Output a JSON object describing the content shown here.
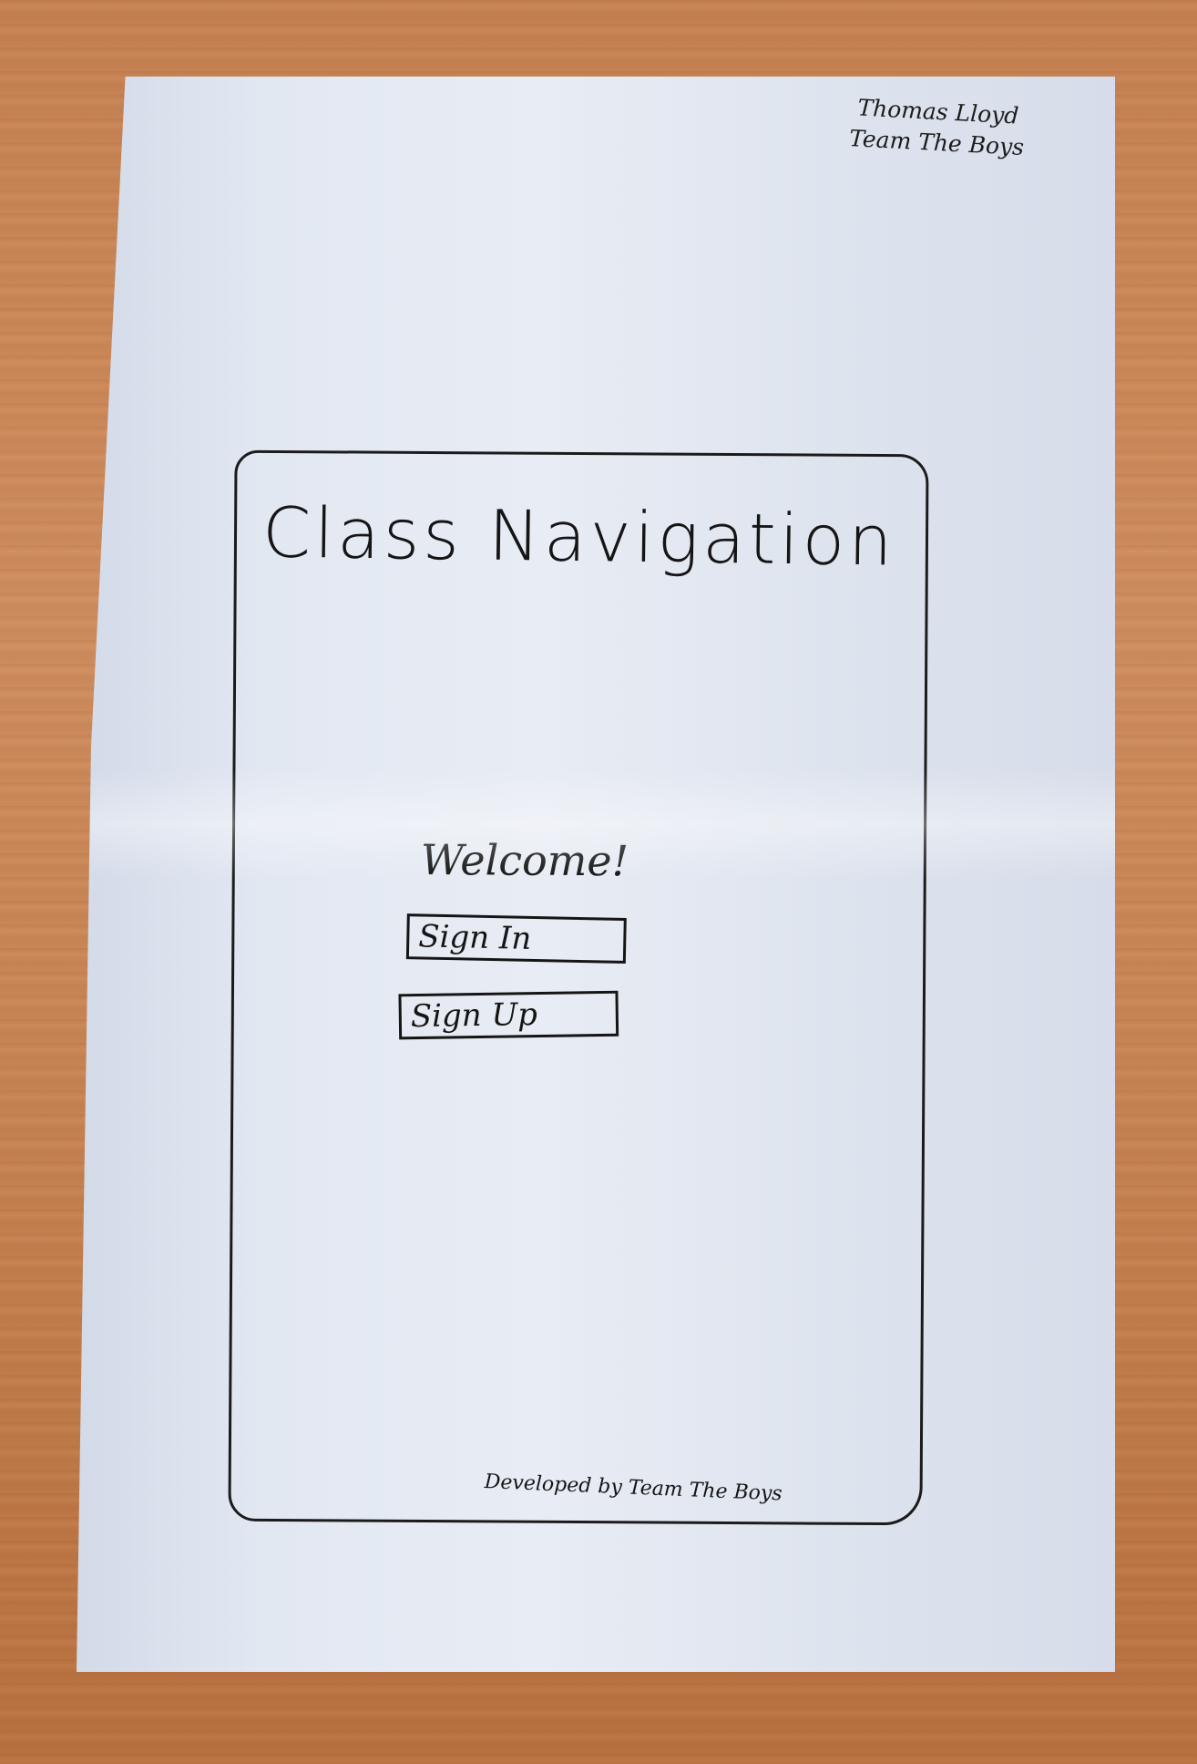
{
  "author": {
    "name": "Thomas Lloyd",
    "team": "Team The Boys"
  },
  "screen": {
    "title": "Class Navigation",
    "welcome": "Welcome!",
    "sign_in_label": "Sign In",
    "sign_up_label": "Sign Up",
    "footer": "Developed by Team The Boys"
  }
}
